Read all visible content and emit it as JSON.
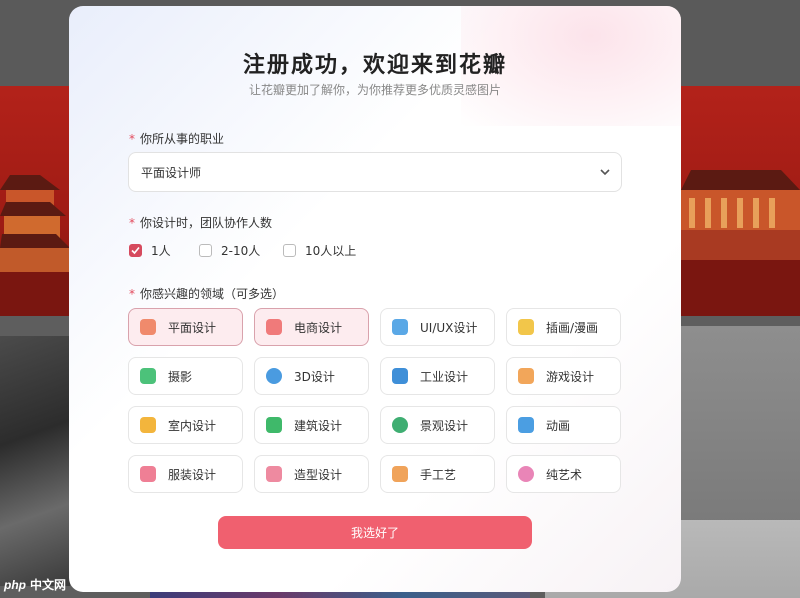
{
  "watermark": {
    "logo": "php",
    "text": "中文网"
  },
  "modal": {
    "title": "注册成功，欢迎来到花瓣",
    "subtitle": "让花瓣更加了解你，为你推荐更多优质灵感图片",
    "occupation": {
      "required_mark": "*",
      "label": "你所从事的职业",
      "selected": "平面设计师",
      "icon": "chevron-down-icon"
    },
    "team": {
      "required_mark": "*",
      "label": "你设计时，团队协作人数",
      "options": [
        {
          "label": "1人",
          "checked": true
        },
        {
          "label": "2-10人",
          "checked": false
        },
        {
          "label": "10人以上",
          "checked": false
        }
      ]
    },
    "interests": {
      "required_mark": "*",
      "label": "你感兴趣的领域（可多选）",
      "items": [
        {
          "label": "平面设计",
          "selected": true,
          "icon": "pen-icon",
          "color": "#f08a6c"
        },
        {
          "label": "电商设计",
          "selected": true,
          "icon": "shop-icon",
          "color": "#f07a7a"
        },
        {
          "label": "UI/UX设计",
          "selected": false,
          "icon": "cube-icon",
          "color": "#5aa8e6"
        },
        {
          "label": "插画/漫画",
          "selected": false,
          "icon": "bulb-icon",
          "color": "#f2c64a"
        },
        {
          "label": "摄影",
          "selected": false,
          "icon": "camera-icon",
          "color": "#4cc27a"
        },
        {
          "label": "3D设计",
          "selected": false,
          "icon": "sphere-icon",
          "color": "#4a9be0"
        },
        {
          "label": "工业设计",
          "selected": false,
          "icon": "gear-icon",
          "color": "#3f8fd8"
        },
        {
          "label": "游戏设计",
          "selected": false,
          "icon": "gamepad-icon",
          "color": "#f2a65a"
        },
        {
          "label": "室内设计",
          "selected": false,
          "icon": "sofa-icon",
          "color": "#f3b53c"
        },
        {
          "label": "建筑设计",
          "selected": false,
          "icon": "building-icon",
          "color": "#3fb96a"
        },
        {
          "label": "景观设计",
          "selected": false,
          "icon": "tree-icon",
          "color": "#3fae72"
        },
        {
          "label": "动画",
          "selected": false,
          "icon": "film-icon",
          "color": "#4b9ee2"
        },
        {
          "label": "服装设计",
          "selected": false,
          "icon": "shirt-icon",
          "color": "#ef7f95"
        },
        {
          "label": "造型设计",
          "selected": false,
          "icon": "figure-icon",
          "color": "#ee8aa0"
        },
        {
          "label": "手工艺",
          "selected": false,
          "icon": "vase-icon",
          "color": "#f0a35a"
        },
        {
          "label": "纯艺术",
          "selected": false,
          "icon": "palette-icon",
          "color": "#e985b7"
        }
      ]
    },
    "submit_label": "我选好了"
  },
  "colors": {
    "accent": "#f0606f",
    "checkbox_checked": "#d64a5e",
    "selected_tile_bg": "#fdecef",
    "banner_red": "#b3221a"
  }
}
